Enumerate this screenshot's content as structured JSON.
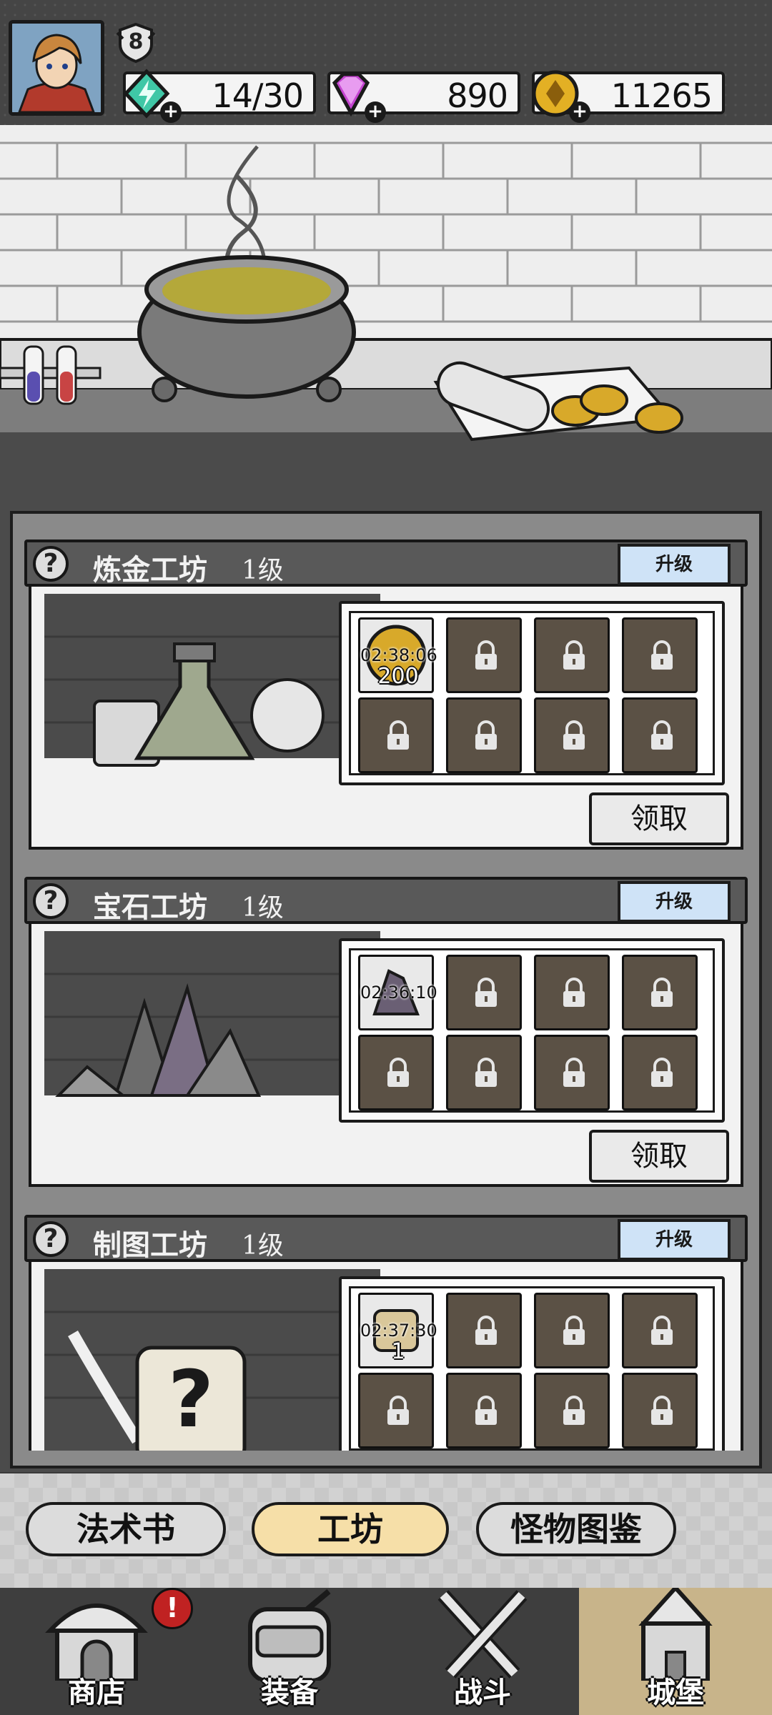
{
  "hud": {
    "level": "8",
    "energy": "14/30",
    "gems": "890",
    "coins": "11265"
  },
  "workshops": [
    {
      "name": "炼金工坊",
      "level": "1级",
      "upgrade_label": "升级",
      "claim_label": "领取",
      "slot_timer": "02:38:06",
      "slot_qty": "200"
    },
    {
      "name": "宝石工坊",
      "level": "1级",
      "upgrade_label": "升级",
      "claim_label": "领取",
      "slot_timer": "02:36:10",
      "slot_qty": ""
    },
    {
      "name": "制图工坊",
      "level": "1级",
      "upgrade_label": "升级",
      "claim_label": "",
      "slot_timer": "02:37:30",
      "slot_qty": "1"
    }
  ],
  "tabs": [
    {
      "label": "法术书",
      "active": false
    },
    {
      "label": "工坊",
      "active": true
    },
    {
      "label": "怪物图鉴",
      "active": false
    }
  ],
  "nav": [
    {
      "label": "商店",
      "icon": "shop-icon",
      "alert": "!"
    },
    {
      "label": "装备",
      "icon": "backpack-icon"
    },
    {
      "label": "战斗",
      "icon": "crossed-swords-icon"
    },
    {
      "label": "城堡",
      "icon": "castle-icon",
      "active": true
    }
  ]
}
